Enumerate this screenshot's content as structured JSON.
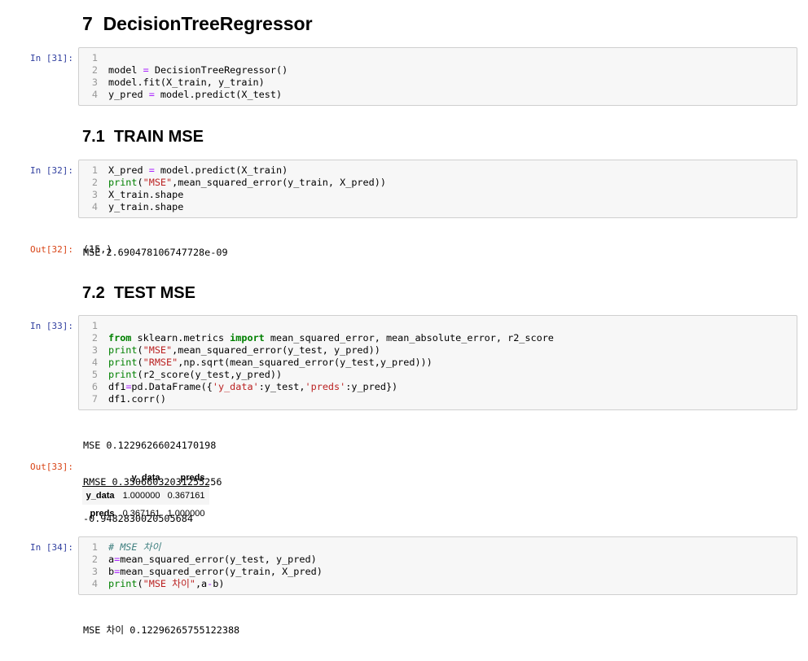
{
  "cells": [
    {
      "heading": "7  DecisionTreeRegressor"
    },
    {
      "prompt": "In [31]:",
      "lines": [
        {
          "n": "1",
          "tok": []
        },
        {
          "n": "2",
          "tok": [
            "model ",
            "=",
            " DecisionTreeRegressor()"
          ]
        },
        {
          "n": "3",
          "tok": [
            "model.fit(X_train, y_train)"
          ]
        },
        {
          "n": "4",
          "tok": [
            "y_pred ",
            "=",
            " model.predict(X_test)"
          ]
        }
      ]
    },
    {
      "heading": "7.1  TRAIN MSE"
    },
    {
      "prompt": "In [32]:",
      "lines": [
        {
          "n": "1",
          "tok": [
            "X_pred ",
            "=",
            " model.predict(X_train)"
          ]
        },
        {
          "n": "2",
          "tok": [
            "print",
            "(",
            "\"MSE\"",
            ",mean_squared_error(y_train, X_pred))"
          ]
        },
        {
          "n": "3",
          "tok": [
            "X_train.shape"
          ]
        },
        {
          "n": "4",
          "tok": [
            "y_train.shape"
          ]
        }
      ],
      "stdout": [
        "MSE 2.690478106747728e-09"
      ],
      "out_prompt": "Out[32]:",
      "result": "(15,)"
    },
    {
      "heading": "7.2  TEST MSE"
    },
    {
      "prompt": "In [33]:",
      "lines": [
        {
          "n": "1",
          "tok": []
        },
        {
          "n": "2",
          "tok": [
            "from",
            " sklearn.metrics ",
            "import",
            " mean_squared_error, mean_absolute_error, r2_score"
          ]
        },
        {
          "n": "3",
          "tok": [
            "print",
            "(",
            "\"MSE\"",
            ",mean_squared_error(y_test, y_pred))"
          ]
        },
        {
          "n": "4",
          "tok": [
            "print",
            "(",
            "\"RMSE\"",
            ",np.sqrt(mean_squared_error(y_test,y_pred)))"
          ]
        },
        {
          "n": "5",
          "tok": [
            "print",
            "(r2_score(y_test,y_pred))"
          ]
        },
        {
          "n": "6",
          "tok": [
            "df1",
            "=",
            "pd.DataFrame({",
            "'y_data'",
            ":y_test,",
            "'preds'",
            ":y_pred})"
          ]
        },
        {
          "n": "7",
          "tok": [
            "df1.corr()"
          ]
        }
      ],
      "stdout": [
        "MSE 0.12296266024170198",
        "RMSE 0.35066032031255256",
        "-0.9482830020505684"
      ],
      "out_prompt": "Out[33]:",
      "table": {
        "columns": [
          "y_data",
          "preds"
        ],
        "rows": [
          {
            "index": "y_data",
            "values": [
              "1.000000",
              "0.367161"
            ]
          },
          {
            "index": "preds",
            "values": [
              "0.367161",
              "1.000000"
            ]
          }
        ]
      }
    },
    {
      "prompt": "In [34]:",
      "lines": [
        {
          "n": "1",
          "tok": [
            "# MSE 차이"
          ]
        },
        {
          "n": "2",
          "tok": [
            "a",
            "=",
            "mean_squared_error(y_test, y_pred)"
          ]
        },
        {
          "n": "3",
          "tok": [
            "b",
            "=",
            "mean_squared_error(y_train, X_pred)"
          ]
        },
        {
          "n": "4",
          "tok": [
            "print",
            "(",
            "\"MSE 차이\"",
            ",a",
            "-",
            "b)"
          ]
        }
      ],
      "stdout": [
        "MSE 차이 0.12296265755122388"
      ]
    }
  ],
  "syntax_colors": {
    "operator": "#AA22FF",
    "builtin": "#008000",
    "string": "#BA2121",
    "keyword": "#008000",
    "comment": "#408080"
  },
  "prompt_colors": {
    "input": "#303F9F",
    "output": "#D84315"
  }
}
